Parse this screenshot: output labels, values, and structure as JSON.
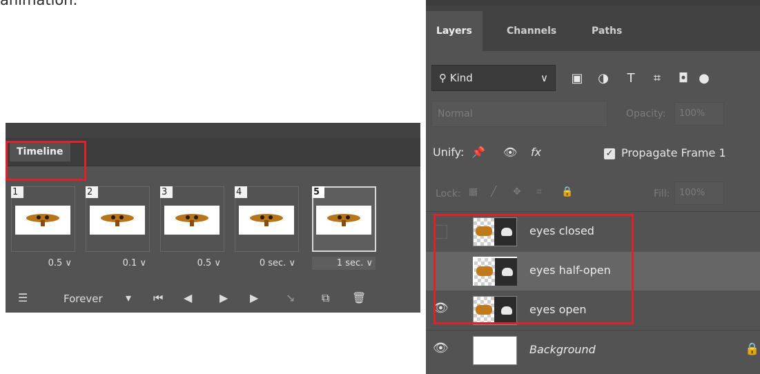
{
  "page_text": "animation.",
  "timeline": {
    "tab_label": "Timeline",
    "frames": [
      {
        "number": "1",
        "delay": "0.5"
      },
      {
        "number": "2",
        "delay": "0.1"
      },
      {
        "number": "3",
        "delay": "0.5"
      },
      {
        "number": "4",
        "delay": "0 sec."
      },
      {
        "number": "5",
        "delay": "1 sec."
      }
    ],
    "loop_label": "Forever",
    "selected_frame": 5
  },
  "layers_panel": {
    "tabs": [
      "Layers",
      "Channels",
      "Paths"
    ],
    "filter_kind": "Kind",
    "blend_mode": "Normal",
    "opacity_label": "Opacity:",
    "opacity_value": "100%",
    "unify_label": "Unify:",
    "propagate_label": "Propagate Frame 1",
    "lock_label": "Lock:",
    "fill_label": "Fill:",
    "fill_value": "100%",
    "layers": [
      {
        "name": "eyes closed",
        "visible": false
      },
      {
        "name": "eyes half-open",
        "visible": false,
        "selected": true
      },
      {
        "name": "eyes open",
        "visible": true
      },
      {
        "name": "Background",
        "visible": true,
        "locked": true
      }
    ]
  },
  "colors": {
    "panel_bg": "#535353",
    "highlight_red": "#e0212c"
  }
}
